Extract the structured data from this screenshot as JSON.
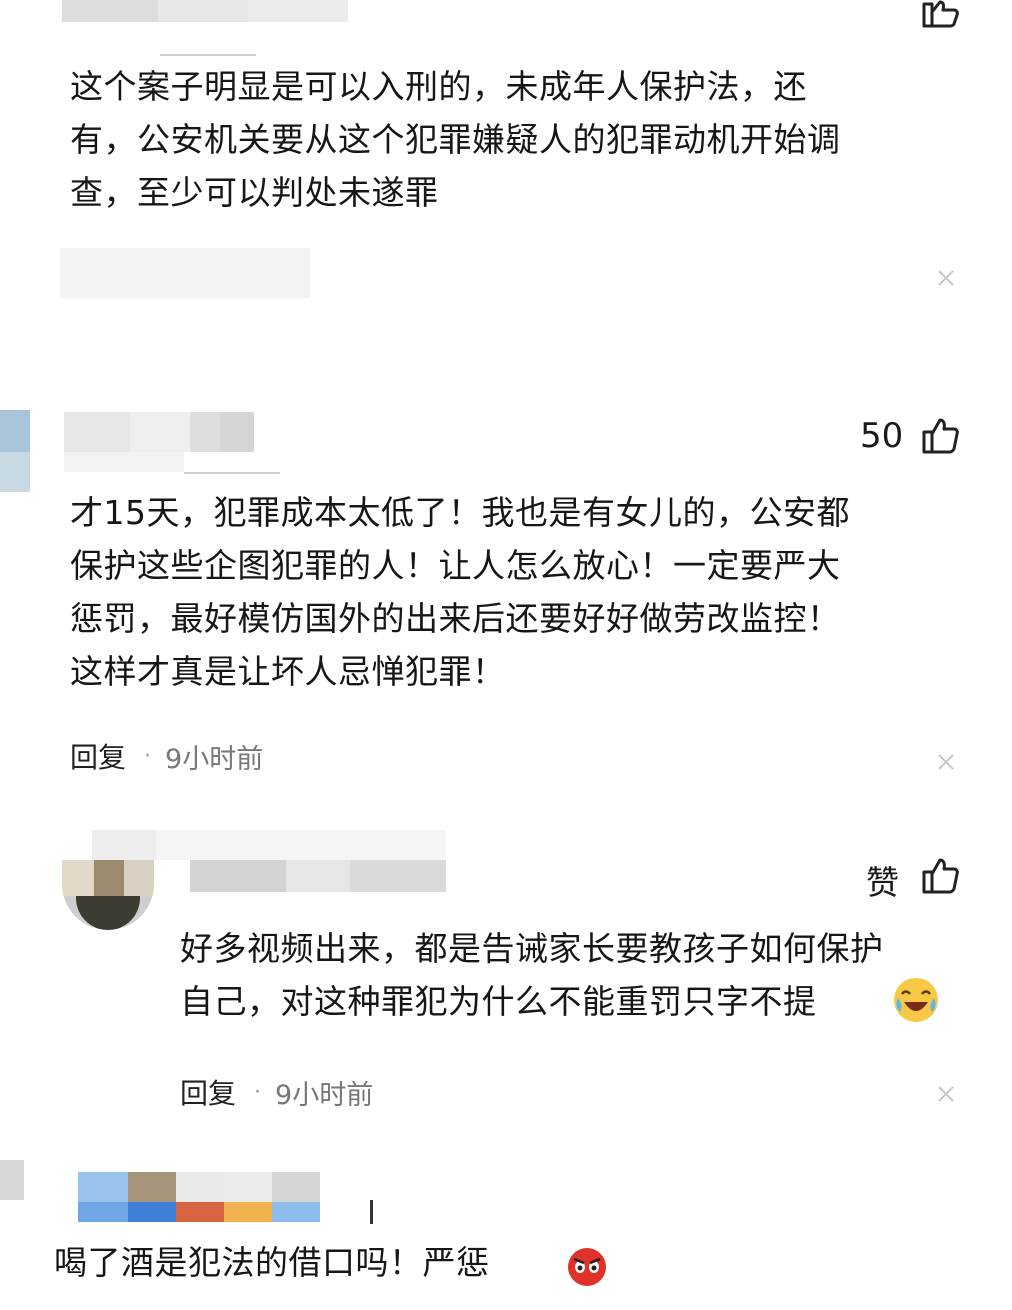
{
  "comments": [
    {
      "text": "这个案子明显是可以入刑的，未成年人保护法，还\n有，公安机关要从这个犯罪嫌疑人的犯罪动机开始调\n查，至少可以判处未遂罪"
    },
    {
      "likes": "50",
      "text": "才15天，犯罪成本太低了！我也是有女儿的，公安都\n保护这些企图犯罪的人！让人怎么放心！一定要严大\n惩罚，最好模仿国外的出来后还要好好做劳改监控！\n这样才真是让坏人忌惮犯罪！",
      "reply_label": "回复",
      "time": "9小时前"
    },
    {
      "like_label": "赞",
      "text": "好多视频出来，都是告诫家长要教孩子如何保护\n自己，对这种罪犯为什么不能重罚只字不提",
      "reply_label": "回复",
      "time": "9小时前"
    },
    {
      "text": "喝了酒是犯法的借口吗！严惩"
    }
  ],
  "icons": {
    "like": "thumbs-up-icon",
    "close": "close-icon",
    "emoji_laugh_cry": "laugh-cry-emoji",
    "emoji_angry": "angry-face-emoji"
  },
  "colors": {
    "text": "#161616",
    "meta": "#777777",
    "close": "#c8c8c8"
  }
}
